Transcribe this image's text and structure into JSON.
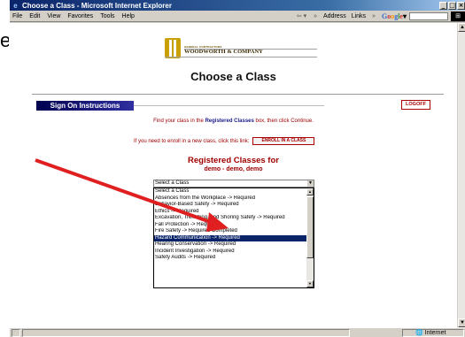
{
  "stray_text": "e.",
  "window": {
    "title": "Choose a Class - Microsoft Internet Explorer"
  },
  "menubar": {
    "items": [
      "File",
      "Edit",
      "View",
      "Favorites",
      "Tools",
      "Help"
    ],
    "address_label": "Address",
    "links_label": "Links",
    "google_label": "Google"
  },
  "page": {
    "logo_small": "GENERAL CONTRACTORS",
    "logo_company": "WOODWORTH & COMPANY",
    "title": "Choose a Class",
    "instructions_label": "Sign On Instructions",
    "logoff_label": "LOGOFF",
    "find_before": "Find your class in the ",
    "find_bold": "Registered Classes",
    "find_after": " box, then click Continue.",
    "enroll_text": "If you need to enroll in a new class, click this link:",
    "enroll_label": "ENROLL IN A CLASS",
    "registered_title": "Registered Classes for",
    "registered_user": "demo - demo, demo"
  },
  "class_select": {
    "selected": "Select a Class",
    "options": [
      "Select a Class",
      "Absences from the Workplace -> Required",
      "Behavior-Based Safety -> Required",
      "Ethics -> Required",
      "Excavation, Trenching, and Shoring Safety -> Required",
      "Fall Protection -> Required",
      "Fire Safety -> Required Completed",
      "Hazard Communication -> Required",
      "Hearing Conservation -> Required",
      "Incident Investigation -> Required",
      "Safety Audits -> Required"
    ],
    "highlighted_index": 7
  },
  "statusbar": {
    "zone": "Internet"
  },
  "colors": {
    "title_bar": "#0a246a",
    "accent_red": "#a00000",
    "annotation_arrow": "#e02020",
    "highlight": "#0a246a"
  }
}
